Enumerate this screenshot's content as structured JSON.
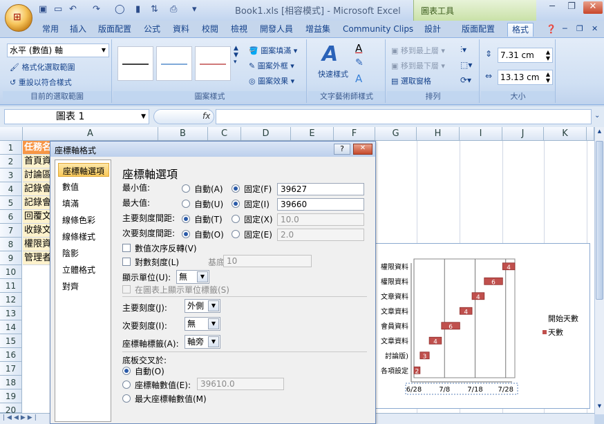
{
  "window": {
    "title": "Book1.xls  [相容模式] - Microsoft Excel",
    "context_tab": "圖表工具"
  },
  "tabs": [
    "常用",
    "插入",
    "版面配置",
    "公式",
    "資料",
    "校閱",
    "檢視",
    "開發人員",
    "增益集",
    "Community Clips",
    "設計",
    "版面配置",
    "格式"
  ],
  "ribbon": {
    "current_selection": "水平 (數值) 軸",
    "format_selection": "格式化選取範圍",
    "reset_style": "重設以符合樣式",
    "group1": "目前的選取範圍",
    "shape_fill": "圖案填滿",
    "shape_outline": "圖案外框",
    "shape_effects": "圖案效果",
    "group2": "圖案樣式",
    "quick_styles": "快速樣式",
    "group3": "文字藝術師樣式",
    "bring_front": "移到最上層",
    "send_back": "移到最下層",
    "selection_pane": "選取窗格",
    "group4": "排列",
    "height": "7.31 cm",
    "width": "13.13 cm",
    "group5": "大小"
  },
  "formula_bar": {
    "name_box": "圖表 1",
    "fx": "fx"
  },
  "sheet": {
    "columns": [
      "A",
      "B",
      "C",
      "D",
      "E",
      "F",
      "G",
      "H",
      "I",
      "J",
      "K"
    ],
    "rows": [
      "1",
      "2",
      "3",
      "4",
      "5",
      "6",
      "7",
      "8",
      "9",
      "10",
      "11",
      "12",
      "13",
      "14",
      "15",
      "16",
      "17",
      "18",
      "19",
      "20"
    ],
    "cellsA": [
      "任務名",
      "首頁資",
      "討論區",
      "記錄會",
      "記錄會",
      "回覆文",
      "收錄文",
      "權限資",
      "管理者"
    ]
  },
  "chart_data": {
    "type": "bar",
    "categories": [
      "各項設定",
      "討論版)",
      "文章資料",
      "會員資料",
      "文章資料",
      "文章資料",
      "權限資料",
      "權限資料"
    ],
    "series": [
      {
        "name": "開始天數",
        "values": [
          39627,
          39629,
          39632,
          39636,
          39642,
          39646,
          39650,
          39656
        ]
      },
      {
        "name": "天數",
        "values": [
          2,
          3,
          4,
          6,
          4,
          4,
          6,
          4
        ]
      }
    ],
    "x_ticks": [
      "6/28",
      "7/8",
      "7/18",
      "7/28"
    ],
    "legend": [
      "開始天數",
      "天數"
    ]
  },
  "dialog": {
    "title": "座標軸格式",
    "help": "?",
    "close": "✕",
    "nav": [
      "座標軸選項",
      "數值",
      "填滿",
      "線條色彩",
      "線條樣式",
      "陰影",
      "立體格式",
      "對齊"
    ],
    "heading": "座標軸選項",
    "min_label": "最小值:",
    "max_label": "最大值:",
    "major_label": "主要刻度間距:",
    "minor_label": "次要刻度間距:",
    "auto_a": "自動(A)",
    "fixed_f": "固定(F)",
    "min_value": "39627",
    "auto_u": "自動(U)",
    "fixed_i": "固定(I)",
    "max_value": "39660",
    "auto_t": "自動(T)",
    "fixed_x": "固定(X)",
    "major_value": "10.0",
    "auto_o": "自動(O)",
    "fixed_e": "固定(E)",
    "minor_value": "2.0",
    "reverse": "數值次序反轉(V)",
    "log": "對數刻度(L)",
    "base_label": "基底(B):",
    "base_value": "10",
    "unit_label": "顯示單位(U):",
    "unit_value": "無",
    "show_unit": "在圖表上顯示單位標籤(S)",
    "major_tick_label": "主要刻度(J):",
    "major_tick_value": "外側",
    "minor_tick_label": "次要刻度(I):",
    "minor_tick_value": "無",
    "axis_label_label": "座標軸標籤(A):",
    "axis_label_value": "軸旁",
    "cross_label": "底板交叉於:",
    "cross_auto": "自動(O)",
    "cross_value_label": "座標軸數值(E):",
    "cross_value": "39610.0",
    "cross_max": "最大座標軸數值(M)"
  }
}
